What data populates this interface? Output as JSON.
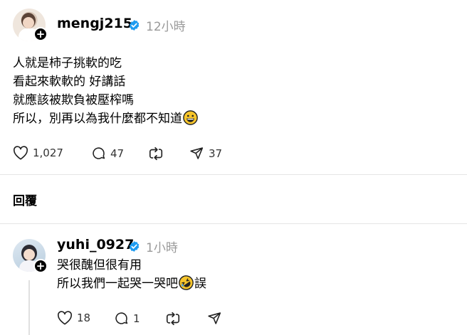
{
  "post": {
    "username": "mengj215",
    "time": "12小時",
    "lines": [
      "人就是柿子挑軟的吃",
      "看起來軟軟的 好講話",
      "就應該被欺負被壓榨嗎",
      "所以，別再以為我什麼都不知道"
    ],
    "likes": "1,027",
    "comments": "47",
    "shares": "37"
  },
  "replies_label": "回覆",
  "reply": {
    "username": "yuhi_0927",
    "time": "1小時",
    "line1": "哭很醜但很有用",
    "line2_before": "所以我們一起哭一哭吧",
    "line2_after": "誤",
    "likes": "18",
    "comments": "1"
  },
  "icons": {
    "verified": "verified-badge-icon",
    "like": "heart-icon",
    "comment": "comment-bubble-icon",
    "repost": "repost-icon",
    "share": "send-icon",
    "follow": "plus-icon",
    "emoji1": "grinning-face-emoji",
    "emoji2": "rolling-on-floor-laughing-emoji"
  },
  "colors": {
    "verified": "#1d9bf0",
    "muted": "#999999",
    "emoji": "#f7c52b"
  }
}
